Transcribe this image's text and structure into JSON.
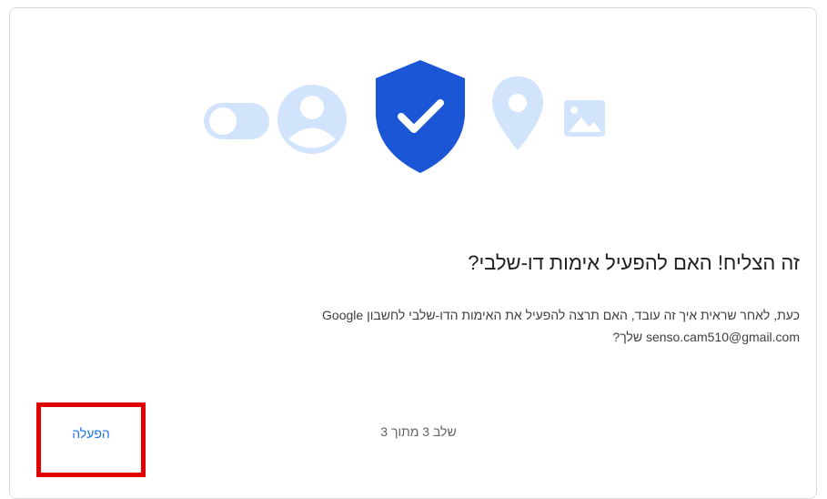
{
  "dialog": {
    "title": "זה הצליח! האם להפעיל אימות דו-שלבי?",
    "body_line1": "כעת, לאחר שראית איך זה עובד, האם תרצה להפעיל את האימות הדו-שלבי לחשבון Google",
    "body_line2": "senso.cam510@gmail.com שלך?",
    "step_text": "שלב 3 מתוך 3",
    "enable_label": "הפעלה"
  },
  "colors": {
    "shield": "#1a56d6",
    "light_icon": "#d2e3fc",
    "link_blue": "#1a73e8",
    "highlight_red": "#e00000"
  },
  "icons": [
    "toggle-icon",
    "account-icon",
    "shield-check-icon",
    "location-pin-icon",
    "image-icon"
  ]
}
